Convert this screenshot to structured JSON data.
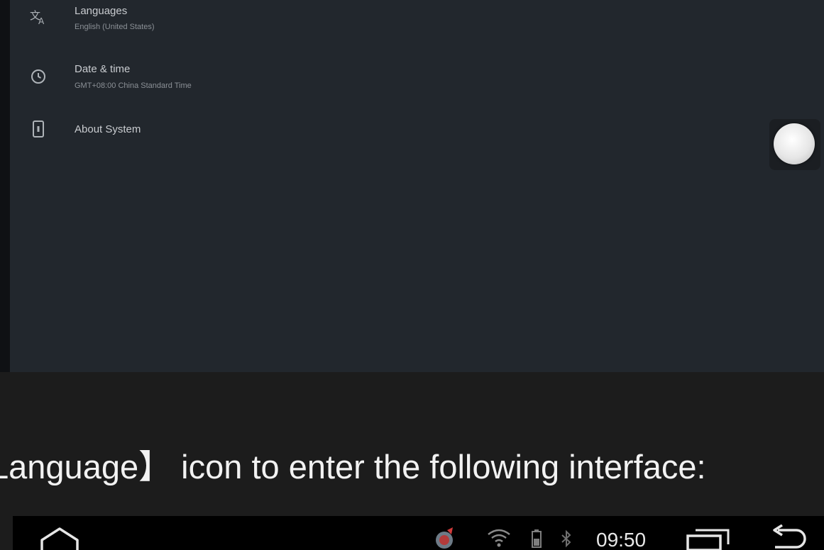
{
  "settings": {
    "items": [
      {
        "title": "Languages",
        "subtitle": "English (United States)",
        "icon": "translate-icon"
      },
      {
        "title": "Date & time",
        "subtitle": "GMT+08:00 China Standard Time",
        "icon": "clock-icon"
      },
      {
        "title": "About System",
        "subtitle": "",
        "icon": "phone-info-icon"
      }
    ]
  },
  "caption": {
    "text": "Language】  icon to enter the following interface:"
  },
  "status_bar": {
    "time": "09:50",
    "icons": [
      "home-icon",
      "app-badge-icon",
      "wifi-icon",
      "battery-icon",
      "bluetooth-icon",
      "recent-apps-icon",
      "back-icon"
    ]
  }
}
